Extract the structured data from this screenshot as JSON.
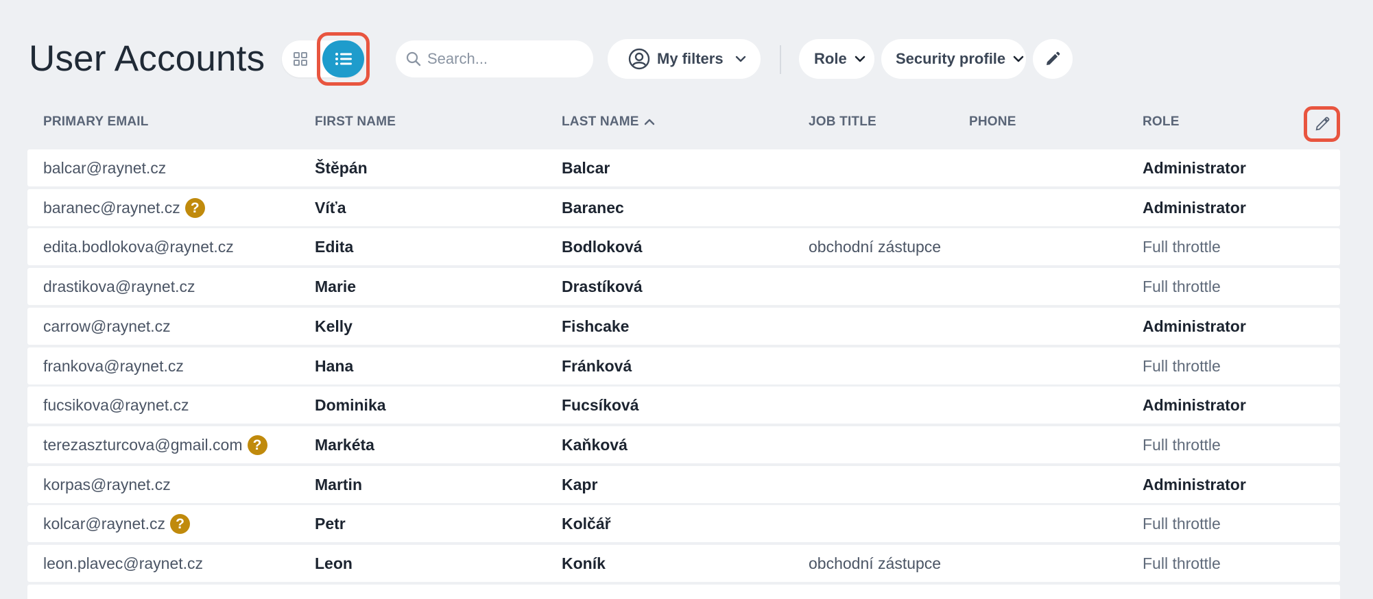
{
  "page": {
    "title": "User Accounts"
  },
  "toolbar": {
    "search_placeholder": "Search...",
    "my_filters_label": "My filters",
    "role_label": "Role",
    "security_profile_label": "Security profile"
  },
  "table": {
    "columns": {
      "email": "PRIMARY EMAIL",
      "first": "FIRST NAME",
      "last": "LAST NAME",
      "job": "JOB TITLE",
      "phone": "PHONE",
      "role": "ROLE"
    },
    "sort_indicator": "^",
    "help_badge": "?",
    "rows": [
      {
        "email": "balcar@raynet.cz",
        "first": "Štěpán",
        "last": "Balcar",
        "job": "",
        "role": "Administrator",
        "help": false
      },
      {
        "email": "baranec@raynet.cz",
        "first": "Víťa",
        "last": "Baranec",
        "job": "",
        "role": "Administrator",
        "help": true
      },
      {
        "email": "edita.bodlokova@raynet.cz",
        "first": "Edita",
        "last": "Bodloková",
        "job": "obchodní zástupce",
        "role": "Full throttle",
        "help": false
      },
      {
        "email": "drastikova@raynet.cz",
        "first": "Marie",
        "last": "Drastíková",
        "job": "",
        "role": "Full throttle",
        "help": false
      },
      {
        "email": "carrow@raynet.cz",
        "first": "Kelly",
        "last": "Fishcake",
        "job": "",
        "role": "Administrator",
        "help": false
      },
      {
        "email": "frankova@raynet.cz",
        "first": "Hana",
        "last": "Fránková",
        "job": "",
        "role": "Full throttle",
        "help": false
      },
      {
        "email": "fucsikova@raynet.cz",
        "first": "Dominika",
        "last": "Fucsíková",
        "job": "",
        "role": "Administrator",
        "help": false
      },
      {
        "email": "terezaszturcova@gmail.com",
        "first": "Markéta",
        "last": "Kaňková",
        "job": "",
        "role": "Full throttle",
        "help": true
      },
      {
        "email": "korpas@raynet.cz",
        "first": "Martin",
        "last": "Kapr",
        "job": "",
        "role": "Administrator",
        "help": false
      },
      {
        "email": "kolcar@raynet.cz",
        "first": "Petr",
        "last": "Kolčář",
        "job": "",
        "role": "Full throttle",
        "help": true
      },
      {
        "email": "leon.plavec@raynet.cz",
        "first": "Leon",
        "last": "Koník",
        "job": "obchodní zástupce",
        "role": "Full throttle",
        "help": false
      }
    ]
  },
  "colors": {
    "accent": "#1e9ccc",
    "highlight": "#e8553f",
    "help_badge": "#c08a0c",
    "background": "#eef0f3"
  },
  "icons": [
    "grid-view-icon",
    "list-view-icon",
    "search-icon",
    "user-circle-icon",
    "chevron-down-icon",
    "pencil-icon"
  ]
}
